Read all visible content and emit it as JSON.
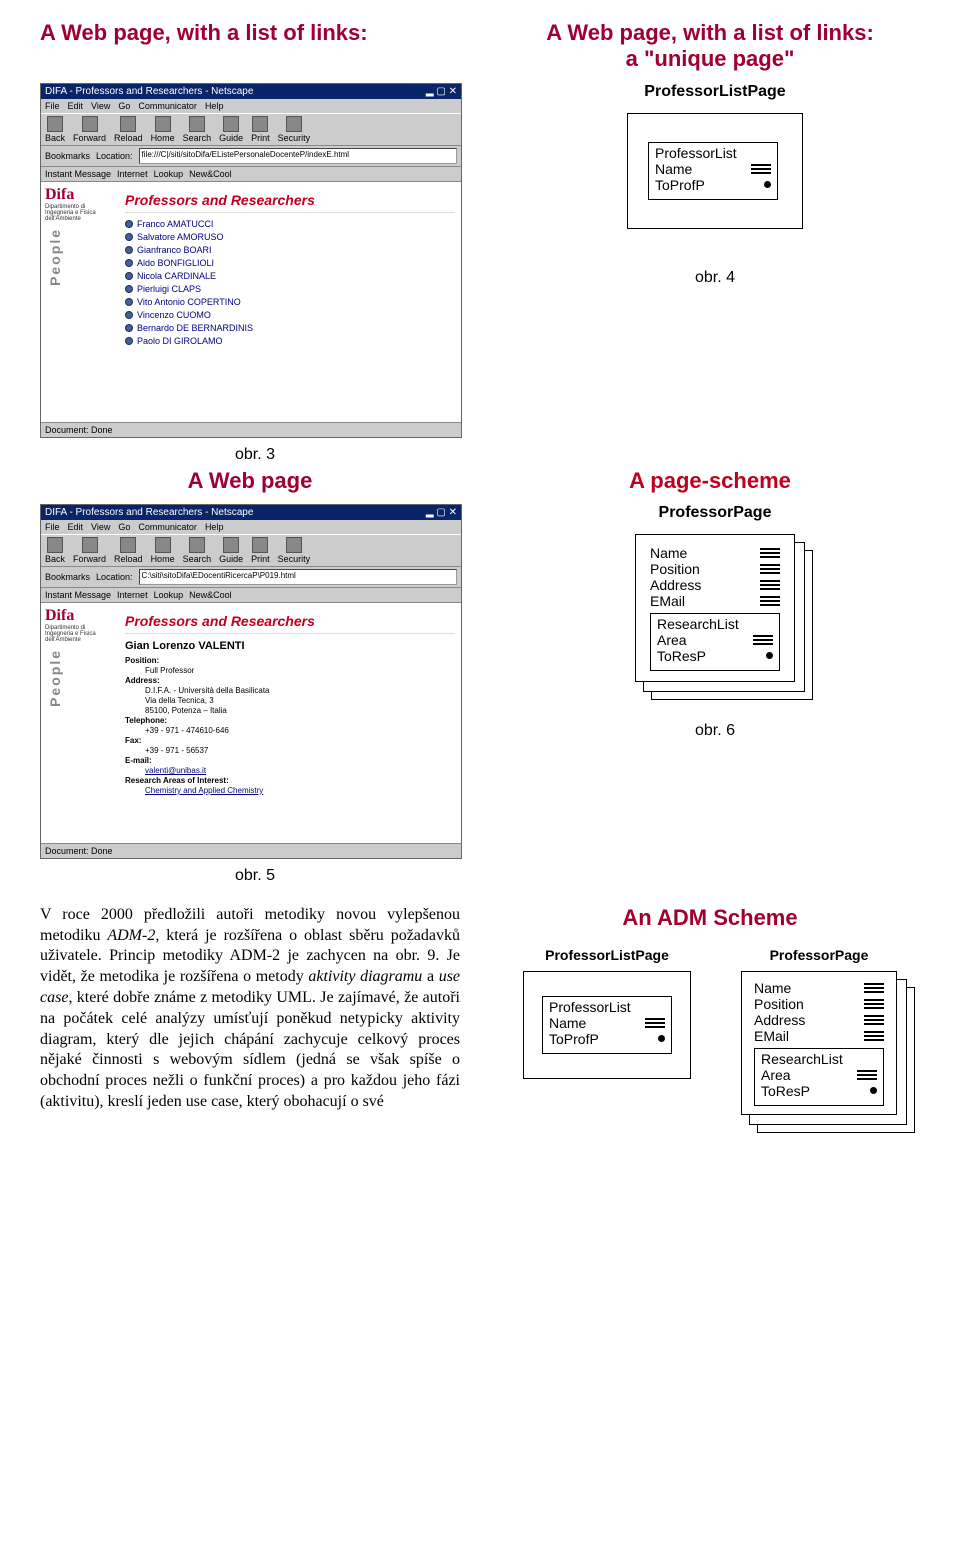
{
  "headings": {
    "top_left": "A Web page, with a list of links:",
    "top_right_line1": "A Web page, with a list of links:",
    "top_right_line2": "a \"unique page\"",
    "mid_left": "A Web page",
    "mid_right": "A page-scheme",
    "adm_scheme": "An ADM Scheme"
  },
  "captions": {
    "obr3": "obr. 3",
    "obr4": "obr. 4",
    "obr5": "obr. 5",
    "obr6": "obr. 6"
  },
  "paragraph": {
    "p1": "V roce 2000 předložili autoři metodiky novou vylepšenou metodiku ",
    "p1_em1": "ADM-2",
    "p1b": ", která je rozšířena o oblast sběru požadavků uživatele. Princip metodiky ADM-2 je zachycen na obr. 9. Je vidět, že metodika je rozšířena o metody ",
    "p1_em2": "aktivity diagramu",
    "p1c": " a ",
    "p1_em3": "use case",
    "p1d": ", které dobře známe z metodiky UML. Je zajímavé, že autoři na počátek celé analýzy umísťují poněkud netypicky aktivity diagram, který dle jejich chápání zachycuje celkový proces nějaké činnosti s webovým sídlem (jedná se však spíše o obchodní proces nežli o funkční proces) a pro každou jeho fázi (aktivitu), kreslí jeden use case, který obohacují o své"
  },
  "browser": {
    "title": "DIFA - Professors and Researchers - Netscape",
    "menus": [
      "File",
      "Edit",
      "View",
      "Go",
      "Communicator",
      "Help"
    ],
    "toolbar": [
      "Back",
      "Forward",
      "Reload",
      "Home",
      "Search",
      "Guide",
      "Print",
      "Security"
    ],
    "location_label": "Bookmarks",
    "location_icon": "Location:",
    "url1": "file:///C|/siti/sitoDifa/EListePersonaleDocenteP/indexE.html",
    "url2": "C:\\siti\\sitoDifa\\EDocentiRicercaP\\P019.html",
    "instant_bar": [
      "Instant Message",
      "Internet",
      "Lookup",
      "New&Cool"
    ],
    "status": "Document: Done",
    "sidebar_logo": "Difa",
    "sidebar_sub": "Dipartimento di Ingegneria e Fisica dell'Ambiente",
    "sidebar_people": "People",
    "content_title": "Professors and Researchers",
    "links": [
      "Franco AMATUCCI",
      "Salvatore AMORUSO",
      "Gianfranco BOARI",
      "Aldo BONFIGLIOLI",
      "Nicola CARDINALE",
      "Pierluigi CLAPS",
      "Vito Antonio COPERTINO",
      "Vincenzo CUOMO",
      "Bernardo DE BERNARDINIS",
      "Paolo DI GIROLAMO"
    ],
    "detail": {
      "name": "Gian Lorenzo VALENTI",
      "fields": {
        "position_lbl": "Position:",
        "position": "Full Professor",
        "address_lbl": "Address:",
        "address1": "D.I.F.A. - Università della Basilicata",
        "address2": "Via della Tecnica, 3",
        "address3": "85100, Potenza – Italia",
        "tel_lbl": "Telephone:",
        "tel": "+39 - 971 - 474610-646",
        "fax_lbl": "Fax:",
        "fax": "+39 - 971 - 56537",
        "email_lbl": "E-mail:",
        "email": "valenti@unibas.it",
        "research_lbl": "Research Areas of Interest:",
        "research": "Chemistry and Applied Chemistry"
      }
    }
  },
  "scheme": {
    "list_page_title": "ProfessorListPage",
    "list_inner_title": "ProfessorList",
    "list_attr1": "Name",
    "list_attr2": "ToProfP",
    "prof_page_title": "ProfessorPage",
    "prof_attrs": [
      "Name",
      "Position",
      "Address",
      "EMail"
    ],
    "research_inner_title": "ResearchList",
    "research_attr1": "Area",
    "research_attr2": "ToResP"
  }
}
